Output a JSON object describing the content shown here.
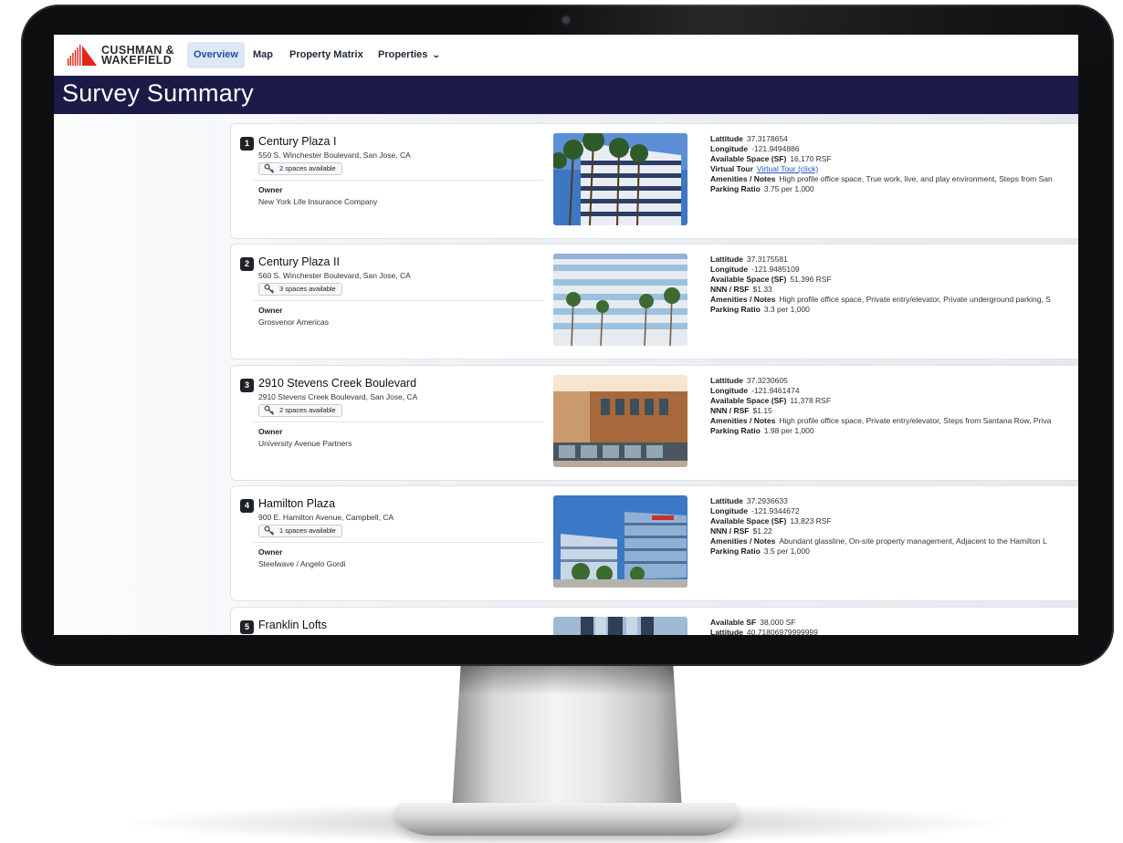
{
  "brand": {
    "line1": "CUSHMAN &",
    "line2": "WAKEFIELD",
    "color": "#e2231a"
  },
  "nav": {
    "overview": "Overview",
    "map": "Map",
    "matrix": "Property Matrix",
    "properties": "Properties"
  },
  "page_title": "Survey Summary",
  "colors": {
    "title_bar": "#1c1a47",
    "active_tab_bg": "#dde7f6",
    "link": "#1a56c9"
  },
  "properties": [
    {
      "num": "1",
      "name": "Century Plaza I",
      "address": "550 S. Winchester Boulevard, San Jose, CA",
      "spaces": "2 spaces available",
      "owner_label": "Owner",
      "owner": "New York Life Insurance Company",
      "details": [
        {
          "label": "Lattitude",
          "value": "37.3178654"
        },
        {
          "label": "Longitude",
          "value": "-121.9494886"
        },
        {
          "label": "Available Space (SF)",
          "value": "16,170 RSF"
        },
        {
          "label": "Virtual Tour",
          "link": "Virtual Tour (click)"
        },
        {
          "label": "Amenities / Notes",
          "value": "High profile office space, True work, live, and play environment, Steps from San"
        },
        {
          "label": "Parking Ratio",
          "value": "3.75 per 1,000"
        }
      ]
    },
    {
      "num": "2",
      "name": "Century Plaza II",
      "address": "560 S. Winchester Boulevard, San Jose, CA",
      "spaces": "3 spaces available",
      "owner_label": "Owner",
      "owner": "Grosvenor Americas",
      "details": [
        {
          "label": "Lattitude",
          "value": "37.3175581"
        },
        {
          "label": "Longitude",
          "value": "-121.9485109"
        },
        {
          "label": "Available Space (SF)",
          "value": "51,396 RSF"
        },
        {
          "label": "NNN / RSF",
          "value": "$1.33"
        },
        {
          "label": "Amenities / Notes",
          "value": "High profile office space, Private entry/elevator, Private underground parking, S"
        },
        {
          "label": "Parking Ratio",
          "value": "3.3 per 1,000"
        }
      ]
    },
    {
      "num": "3",
      "name": "2910 Stevens Creek Boulevard",
      "address": "2910 Stevens Creek Boulevard, San Jose, CA",
      "spaces": "2 spaces available",
      "owner_label": "Owner",
      "owner": "University Avenue Partners",
      "details": [
        {
          "label": "Lattitude",
          "value": "37.3230605"
        },
        {
          "label": "Longitude",
          "value": "-121.9461474"
        },
        {
          "label": "Available Space (SF)",
          "value": "11,378 RSF"
        },
        {
          "label": "NNN / RSF",
          "value": "$1.15"
        },
        {
          "label": "Amenities / Notes",
          "value": "High profile office space, Private entry/elevator, Steps from Santana Row, Priva"
        },
        {
          "label": "Parking Ratio",
          "value": "1.98 per 1,000"
        }
      ]
    },
    {
      "num": "4",
      "name": "Hamilton Plaza",
      "address": "900 E. Hamilton Avenue, Campbell, CA",
      "spaces": "1 spaces available",
      "owner_label": "Owner",
      "owner": "Steelwave / Angelo Gordi",
      "details": [
        {
          "label": "Lattitude",
          "value": "37.2936633"
        },
        {
          "label": "Longitude",
          "value": "-121.9344672"
        },
        {
          "label": "Available Space (SF)",
          "value": "13,823 RSF"
        },
        {
          "label": "NNN / RSF",
          "value": "$1.22"
        },
        {
          "label": "Amenities / Notes",
          "value": "Abundant glassline, On-site property management, Adjacent to the Hamilton L"
        },
        {
          "label": "Parking Ratio",
          "value": "3.5 per 1,000"
        }
      ]
    },
    {
      "num": "5",
      "name": "Franklin Lofts",
      "address": "",
      "spaces": "",
      "owner_label": "",
      "owner": "",
      "details": [
        {
          "label": "Available SF",
          "value": "38,000 SF"
        },
        {
          "label": "Lattitude",
          "value": "40.71806979999999"
        }
      ]
    }
  ]
}
